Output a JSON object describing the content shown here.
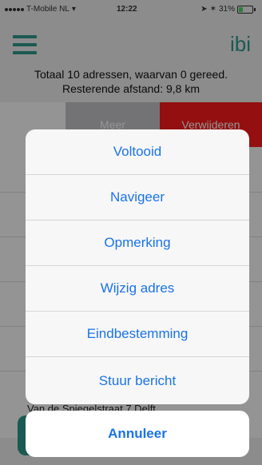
{
  "status_bar": {
    "carrier": "T-Mobile NL",
    "time": "12:22",
    "battery": "31%"
  },
  "header": {
    "logo": "ibi",
    "menu_icon": "hamburger-menu-icon"
  },
  "summary": {
    "line1": "Totaal 10 adressen, waarvan 0 gereed.",
    "line2": "Resterende afstand: 9,8 km"
  },
  "list": {
    "swipe_more": "Meer",
    "swipe_delete": "Verwijderen",
    "peek_address": "Van de Spiegelstraat 7 Delft"
  },
  "action_sheet": {
    "items": [
      {
        "label": "Voltooid"
      },
      {
        "label": "Navigeer"
      },
      {
        "label": "Opmerking"
      },
      {
        "label": "Wijzig adres"
      },
      {
        "label": "Eindbestemming"
      },
      {
        "label": "Stuur bericht"
      }
    ],
    "cancel_label": "Annuleer"
  },
  "colors": {
    "brand": "#2f9c8e",
    "action": "#1a73e8",
    "delete": "#ff1a1a"
  }
}
